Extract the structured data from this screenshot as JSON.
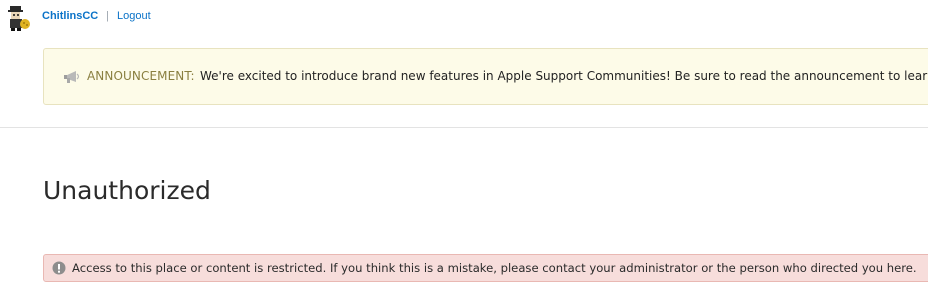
{
  "user": {
    "name": "ChitlinsCC",
    "separator": "|",
    "logout_label": "Logout",
    "avatar_icon": "user-avatar"
  },
  "announcement": {
    "icon": "megaphone-icon",
    "label": "ANNOUNCEMENT:",
    "text": "We're excited to introduce brand new features in Apple Support Communities! Be sure to read the announcement to learn mo"
  },
  "page": {
    "title": "Unauthorized"
  },
  "alert": {
    "icon": "info-icon",
    "message": "Access to this place or content is restricted. If you think this is a mistake, please contact your administrator or the person who directed you here."
  },
  "colors": {
    "link": "#0b73c8",
    "announcement_bg": "#fdfbe8",
    "announcement_label": "#8a7f40",
    "alert_bg": "#f7dddb",
    "alert_border": "#e9b8b3"
  }
}
